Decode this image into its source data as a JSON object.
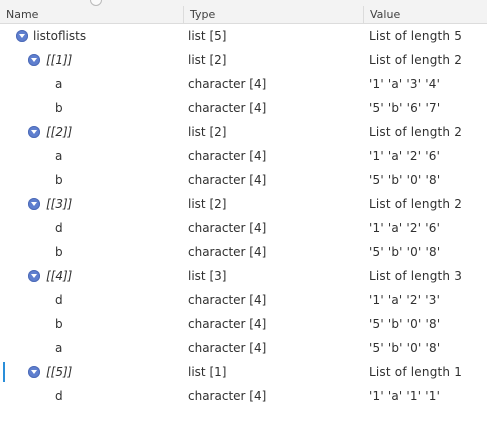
{
  "header": {
    "name_label": "Name",
    "type_label": "Type",
    "value_label": "Value"
  },
  "rows": [
    {
      "level": 0,
      "expandable": true,
      "italic": false,
      "name": "listoflists",
      "type": "list [5]",
      "value": "List of length 5"
    },
    {
      "level": 1,
      "expandable": true,
      "italic": true,
      "name": "[[1]]",
      "type": "list [2]",
      "value": "List of length 2"
    },
    {
      "level": 2,
      "expandable": false,
      "italic": false,
      "name": "a",
      "type": "character [4]",
      "value": "'1' 'a' '3' '4'"
    },
    {
      "level": 2,
      "expandable": false,
      "italic": false,
      "name": "b",
      "type": "character [4]",
      "value": "'5' 'b' '6' '7'"
    },
    {
      "level": 1,
      "expandable": true,
      "italic": true,
      "name": "[[2]]",
      "type": "list [2]",
      "value": "List of length 2"
    },
    {
      "level": 2,
      "expandable": false,
      "italic": false,
      "name": "a",
      "type": "character [4]",
      "value": "'1' 'a' '2' '6'"
    },
    {
      "level": 2,
      "expandable": false,
      "italic": false,
      "name": "b",
      "type": "character [4]",
      "value": "'5' 'b' '0' '8'"
    },
    {
      "level": 1,
      "expandable": true,
      "italic": true,
      "name": "[[3]]",
      "type": "list [2]",
      "value": "List of length 2"
    },
    {
      "level": 2,
      "expandable": false,
      "italic": false,
      "name": "d",
      "type": "character [4]",
      "value": "'1' 'a' '2' '6'"
    },
    {
      "level": 2,
      "expandable": false,
      "italic": false,
      "name": "b",
      "type": "character [4]",
      "value": "'5' 'b' '0' '8'"
    },
    {
      "level": 1,
      "expandable": true,
      "italic": true,
      "name": "[[4]]",
      "type": "list [3]",
      "value": "List of length 3"
    },
    {
      "level": 2,
      "expandable": false,
      "italic": false,
      "name": "d",
      "type": "character [4]",
      "value": "'1' 'a' '2' '3'"
    },
    {
      "level": 2,
      "expandable": false,
      "italic": false,
      "name": "b",
      "type": "character [4]",
      "value": "'5' 'b' '0' '8'"
    },
    {
      "level": 2,
      "expandable": false,
      "italic": false,
      "name": "a",
      "type": "character [4]",
      "value": "'5' 'b' '0' '8'"
    },
    {
      "level": 1,
      "expandable": true,
      "italic": true,
      "name": "[[5]]",
      "type": "list [1]",
      "value": "List of length 1",
      "focused": true
    },
    {
      "level": 2,
      "expandable": false,
      "italic": false,
      "name": "d",
      "type": "character [4]",
      "value": "'1' 'a' '1' '1'"
    }
  ],
  "icons": {
    "expand_toggle": "expanded-chevron-icon"
  },
  "colors": {
    "toggle": "#5f7fcf",
    "focus_bar": "#2a8ed9",
    "header_bg": "#f3f3f3"
  }
}
